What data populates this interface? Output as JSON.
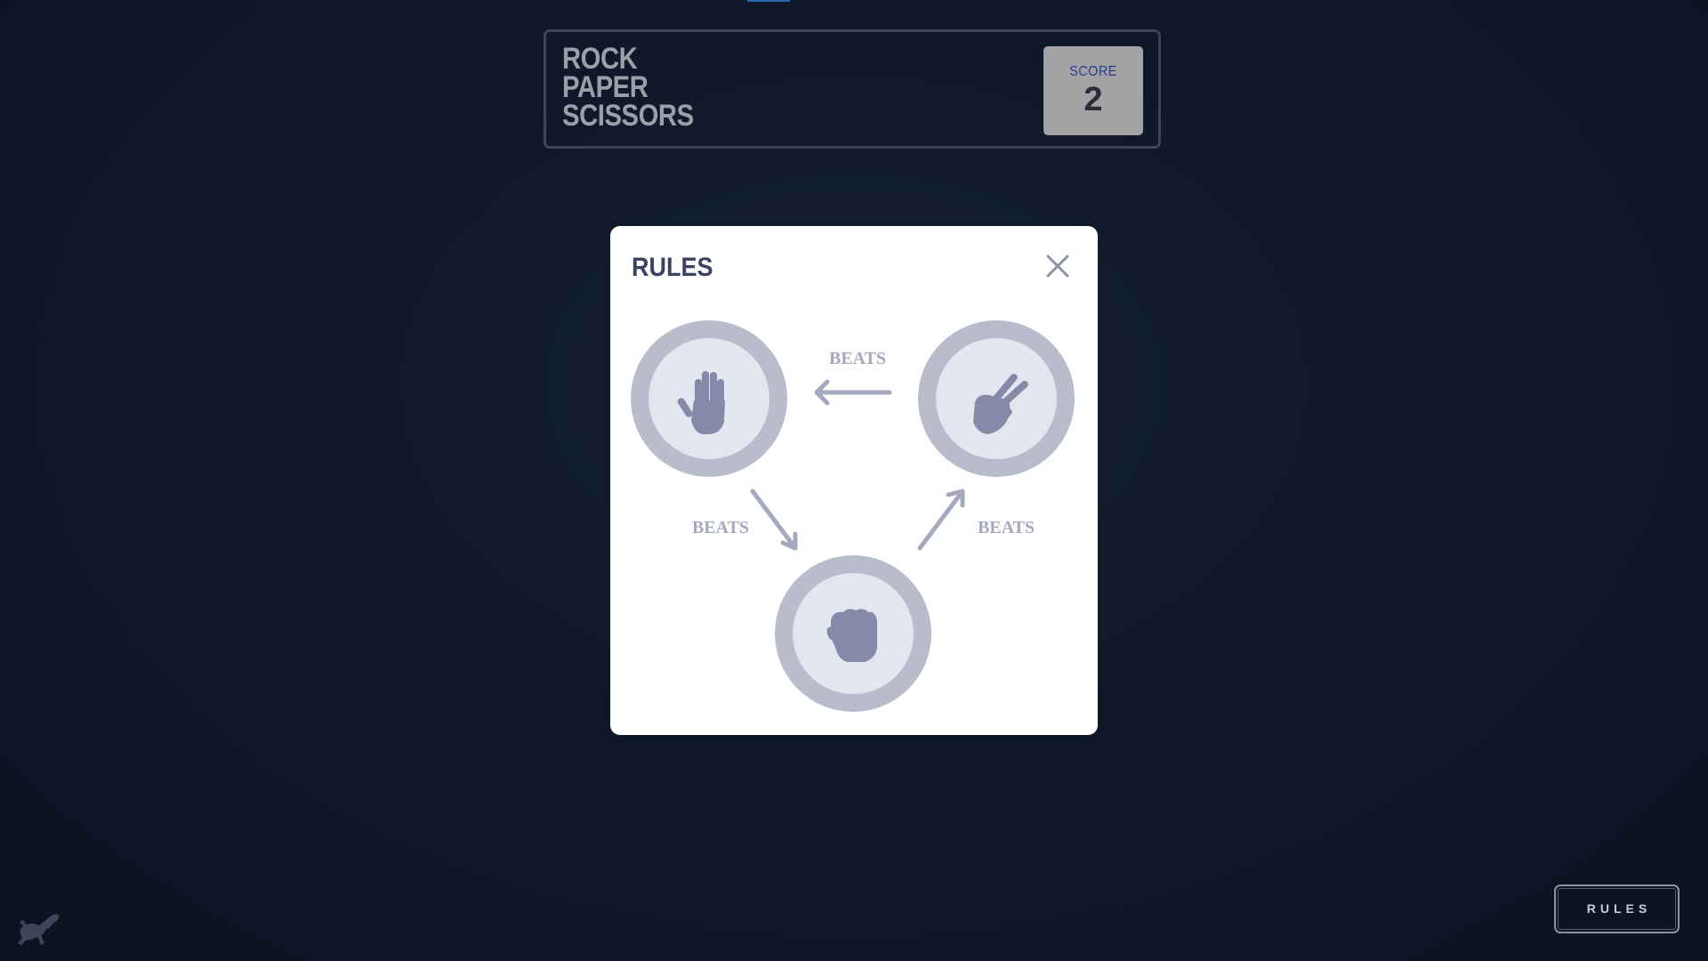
{
  "header": {
    "title_lines": [
      "ROCK",
      "PAPER",
      "SCISSORS"
    ],
    "score_label": "SCORE",
    "score_value": "2"
  },
  "modal": {
    "title": "RULES",
    "close_icon": "close-icon",
    "choices": [
      {
        "name": "paper",
        "icon": "paper-hand-icon"
      },
      {
        "name": "scissors",
        "icon": "scissors-hand-icon"
      },
      {
        "name": "rock",
        "icon": "rock-fist-icon"
      }
    ],
    "beats_labels": {
      "scissors_paper": "BEATS",
      "paper_rock": "BEATS",
      "rock_scissors": "BEATS"
    }
  },
  "footer": {
    "rules_button": "RULES",
    "mascot_icon": "gecko-icon"
  },
  "colors": {
    "background": "#0f1829",
    "header_border": "#3a4656",
    "score_box": "#a3a3a5",
    "score_label": "#2a3a8a",
    "modal_title": "#3b4262",
    "circle_outer": "#b9bccd",
    "circle_inner": "#e3e5ef",
    "hand_icon": "#848aa7",
    "beats_text": "#a5a9c0"
  }
}
